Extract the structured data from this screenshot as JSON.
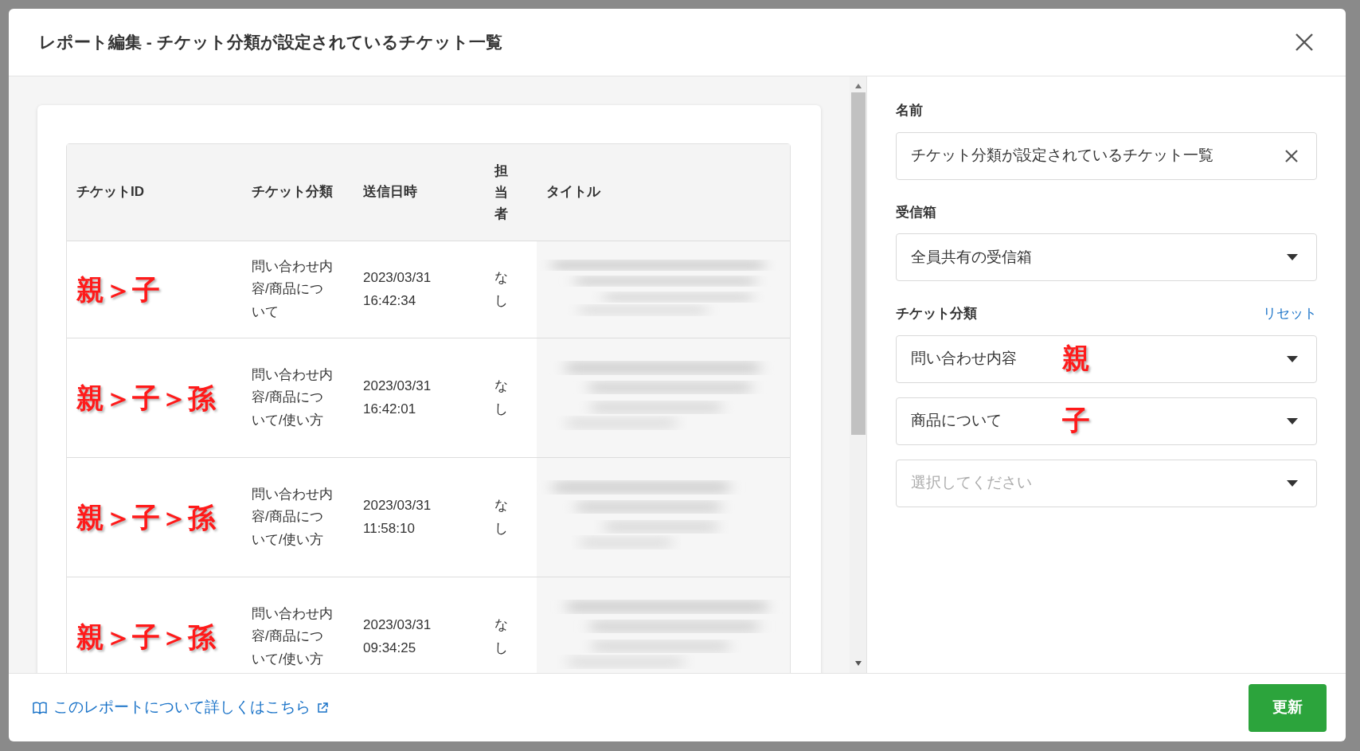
{
  "dialog": {
    "title": "レポート編集 - チケット分類が設定されているチケット一覧"
  },
  "table": {
    "columns": [
      "チケットID",
      "チケット分類",
      "送信日時",
      "担当者",
      "タイトル"
    ],
    "rows": [
      {
        "annotation": "親＞子",
        "category": "問い合わせ内容/商品について",
        "sent": "2023/03/31 16:42:34",
        "assignee": "なし"
      },
      {
        "annotation": "親＞子＞孫",
        "category": "問い合わせ内容/商品について/使い方",
        "sent": "2023/03/31 16:42:01",
        "assignee": "なし"
      },
      {
        "annotation": "親＞子＞孫",
        "category": "問い合わせ内容/商品について/使い方",
        "sent": "2023/03/31 11:58:10",
        "assignee": "なし"
      },
      {
        "annotation": "親＞子＞孫",
        "category": "問い合わせ内容/商品について/使い方",
        "sent": "2023/03/31 09:34:25",
        "assignee": "なし"
      }
    ]
  },
  "form": {
    "name_label": "名前",
    "name_value": "チケット分類が設定されているチケット一覧",
    "inbox_label": "受信箱",
    "inbox_value": "全員共有の受信箱",
    "category_label": "チケット分類",
    "reset_link": "リセット",
    "category_selects": [
      {
        "value": "問い合わせ内容",
        "annotation": "親"
      },
      {
        "value": "商品について",
        "annotation": "子"
      },
      {
        "placeholder": "選択してください"
      }
    ]
  },
  "footer": {
    "help_link": "このレポートについて詳しくはこちら",
    "submit_button": "更新"
  }
}
